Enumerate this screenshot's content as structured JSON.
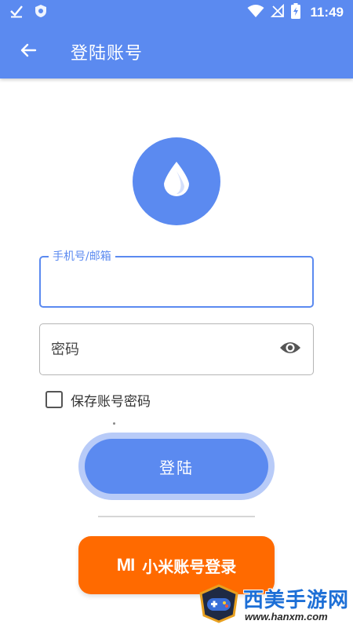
{
  "status_bar": {
    "time": "11:49",
    "icons": [
      "check-notification-icon",
      "shield-notification-icon",
      "wifi-icon",
      "no-signal-icon",
      "battery-charging-icon"
    ]
  },
  "app_bar": {
    "title": "登陆账号",
    "back_icon": "arrow-left-icon"
  },
  "logo": {
    "icon": "water-drop-icon",
    "color": "#5b8af0"
  },
  "form": {
    "account": {
      "label": "手机号/邮箱",
      "value": ""
    },
    "password": {
      "placeholder": "密码",
      "value": "",
      "toggle_icon": "eye-icon"
    },
    "remember": {
      "label": "保存账号密码",
      "checked": false
    },
    "login_button": "登陆"
  },
  "xiaomi_login": {
    "logo": "MI",
    "label": "小米账号登录",
    "color": "#ff6a00"
  },
  "watermark": {
    "text": "西美手游网",
    "url": "www.hanxm.com"
  },
  "colors": {
    "primary": "#5b8af0",
    "halo": "#b8cbf8",
    "accent_orange": "#ff6a00"
  }
}
